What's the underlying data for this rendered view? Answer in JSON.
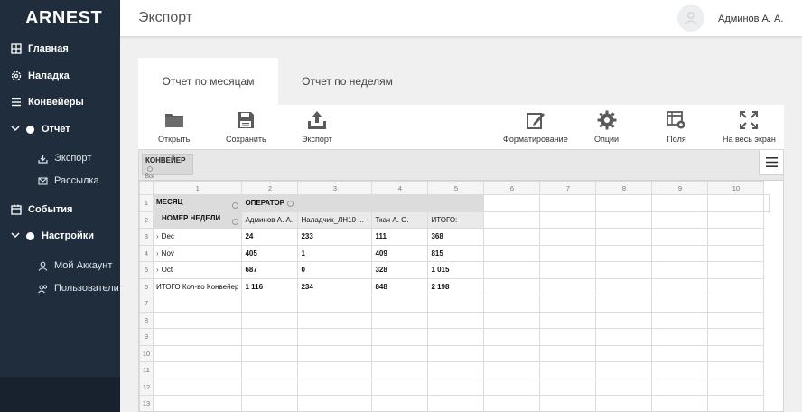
{
  "app": {
    "logo": "ARNEST"
  },
  "sidebar": {
    "items": [
      {
        "label": "Главная",
        "icon": "grid-icon"
      },
      {
        "label": "Наладка",
        "icon": "gear-icon"
      },
      {
        "label": "Конвейеры",
        "icon": "list-icon"
      },
      {
        "label": "Отчет",
        "icon": "dot-icon",
        "expanded": true
      },
      {
        "label": "События",
        "icon": "calendar-icon"
      },
      {
        "label": "Настройки",
        "icon": "dot-icon",
        "expanded": true
      }
    ],
    "report_sub": [
      {
        "label": "Экспорт",
        "icon": "download-icon"
      },
      {
        "label": "Рассылка",
        "icon": "mail-icon"
      }
    ],
    "settings_sub": [
      {
        "label": "Мой Аккаунт",
        "icon": "user-icon"
      },
      {
        "label": "Пользователи",
        "icon": "users-icon"
      }
    ]
  },
  "header": {
    "title": "Экспорт",
    "user": "Админов А. А."
  },
  "tabs": [
    {
      "label": "Отчет по месяцам",
      "active": true
    },
    {
      "label": "Отчет по неделям",
      "active": false
    }
  ],
  "toolbar": {
    "open": "Открыть",
    "save": "Сохранить",
    "export": "Экспорт",
    "format": "Форматирование",
    "options": "Опции",
    "fields": "Поля",
    "fullscreen": "На весь экран"
  },
  "pivot": {
    "filter": {
      "title": "КОНВЕЙЕР",
      "value": "Все"
    },
    "col_numbers": [
      "1",
      "2",
      "3",
      "4",
      "5",
      "6",
      "7",
      "8",
      "9",
      "10"
    ],
    "row_numbers": [
      "1",
      "2",
      "3",
      "4",
      "5",
      "6",
      "7",
      "8",
      "9",
      "10",
      "11",
      "12",
      "13"
    ],
    "month_label": "МЕСЯЦ",
    "operator_label": "ОПЕРАТОР",
    "week_label": "НОМЕР НЕДЕЛИ",
    "operators": [
      "Админов А. А.",
      "Наладчик_ЛН10 ...",
      "Ткач А. О.",
      "ИТОГО:"
    ],
    "rows": [
      {
        "label": "Dec",
        "values": [
          "24",
          "233",
          "111",
          "368"
        ]
      },
      {
        "label": "Nov",
        "values": [
          "405",
          "1",
          "409",
          "815"
        ]
      },
      {
        "label": "Oct",
        "values": [
          "687",
          "0",
          "328",
          "1 015"
        ]
      }
    ],
    "total": {
      "label": "ИТОГО Кол-во Конвейер",
      "values": [
        "1 116",
        "234",
        "848",
        "2 198"
      ]
    }
  },
  "colors": {
    "sidebar": "#1f2d3d",
    "header_bg": "#ffffff",
    "page_bg": "#f0f0f0",
    "toolbar_icon": "#555555"
  }
}
